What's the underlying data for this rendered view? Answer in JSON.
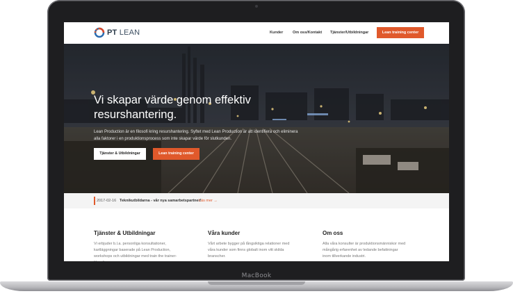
{
  "device": {
    "brand": "MacBook"
  },
  "nav": {
    "logo": {
      "text_bold": "PT",
      "text_light": "LEAN"
    },
    "links": [
      "Kunder",
      "Om oss/Kontakt",
      "Tjänster/Utbildningar"
    ],
    "cta": "Lean training center"
  },
  "hero": {
    "title": "Vi skapar värde genom effektiv resurshantering.",
    "subtitle": "Lean Production är en filosofi kring resurshantering. Syftet med Lean Production är att identifiera och eliminera alla faktorer i en produktionsprocess som inte skapar värde för slutkunden.",
    "primary_button": "Tjänster & Utbildningar",
    "secondary_button": "Lean training center"
  },
  "news": {
    "date": "2017-02-16",
    "title": "Teknikutbildarna - vår nya samarbetspartner!",
    "more": "Läs mer →"
  },
  "columns": [
    {
      "title": "Tjänster & Utbildningar",
      "text": "Vi erbjuder b.l.a. personliga konsultationer, kartläggningar baserade på Lean Production, workshops och utbildningar med train the trainer-filosofi."
    },
    {
      "title": "Våra kunder",
      "text": "Vårt arbete bygger på långsiktiga relationer med våra kunder som finns globalt inom vitt skilda branscher."
    },
    {
      "title": "Om oss",
      "text": "Alla våra konsulter är produktionsmänniskor med mångårig erfarenhet av ledande befattningar inom tillverkande industri."
    }
  ],
  "colors": {
    "accent": "#e0592b",
    "logo_blue": "#2b6cb0",
    "logo_red": "#d9482b"
  }
}
